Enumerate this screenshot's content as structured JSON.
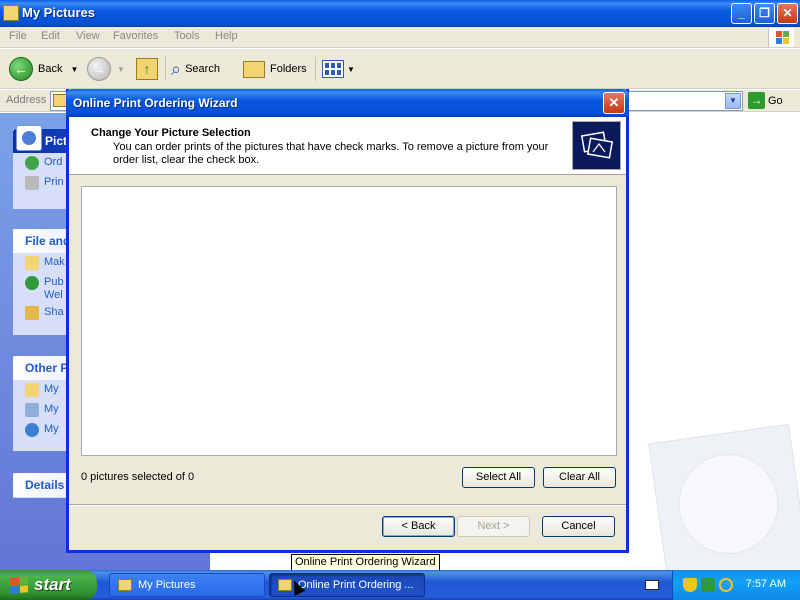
{
  "explorer": {
    "title": "My Pictures",
    "menu": [
      "File",
      "Edit",
      "View",
      "Favorites",
      "Tools",
      "Help"
    ],
    "toolbar": {
      "back_label": "Back",
      "search_label": "Search",
      "folders_label": "Folders"
    },
    "address_label": "Address",
    "go_label": "Go",
    "taskpane": {
      "picture_tasks_title": "Pict",
      "picture_tasks": [
        "Ord",
        "Prin"
      ],
      "file_tasks_title": "File and",
      "file_tasks": [
        "Mak",
        "Pub",
        "Wel",
        "Sha"
      ],
      "other_places_title": "Other P",
      "other_places": [
        "My",
        "My",
        "My"
      ],
      "details_title": "Details"
    }
  },
  "wizard": {
    "title": "Online Print Ordering Wizard",
    "header_title": "Change Your Picture Selection",
    "header_desc": "You can order prints of the pictures that have check marks. To remove a picture from your order list, clear the check box.",
    "status": "0 pictures selected of 0",
    "select_all_label": "Select All",
    "clear_all_label": "Clear All",
    "back_label": "< Back",
    "next_label": "Next >",
    "cancel_label": "Cancel"
  },
  "tooltip": "Online Print Ordering Wizard",
  "taskbar": {
    "start_label": "start",
    "tasks": [
      "My Pictures",
      "Online Print Ordering ..."
    ],
    "clock": "7:57 AM"
  },
  "colors": {
    "titlebar_blue": "#0550d6",
    "taskpane_blue": "#6375d6",
    "start_green": "#3c8f3c",
    "tray_blue": "#0f8ced"
  }
}
